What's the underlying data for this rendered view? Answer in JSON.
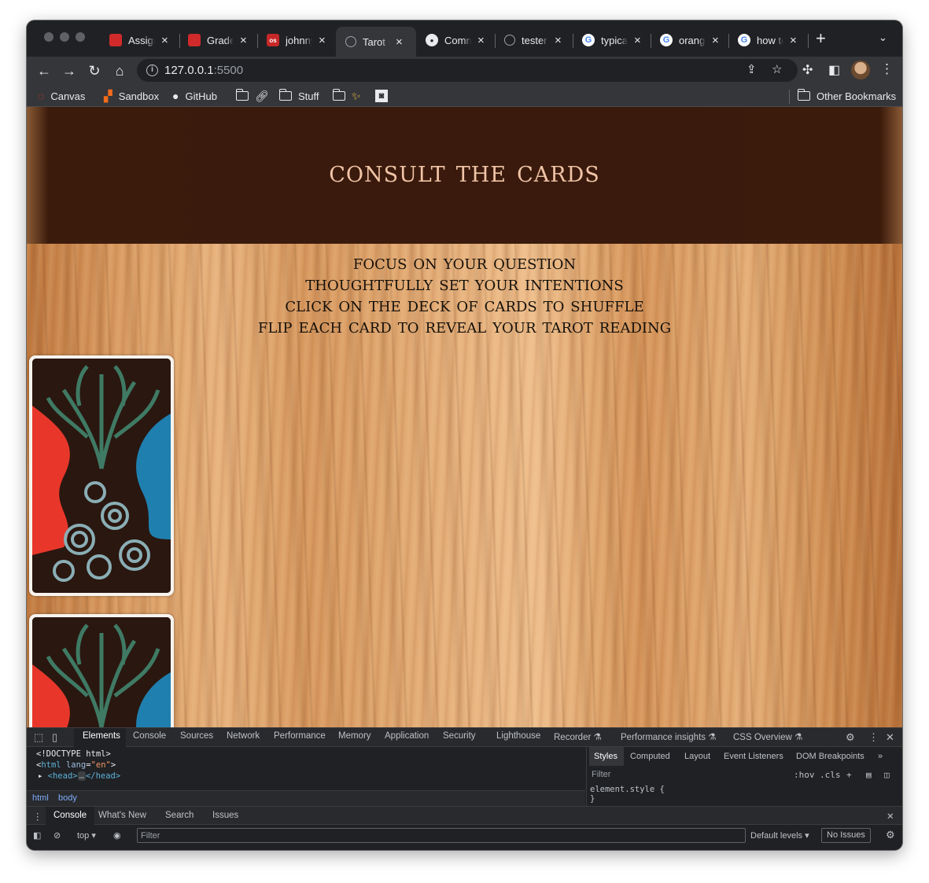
{
  "browser": {
    "tabs": [
      {
        "title": "Assignments",
        "favicon": "red-square-icon",
        "color": "#d12a2a"
      },
      {
        "title": "Grades",
        "favicon": "red-square-icon",
        "color": "#d12a2a"
      },
      {
        "title": "johnny",
        "favicon": "os-icon",
        "color": "#c62828"
      },
      {
        "title": "Tarot Cards",
        "favicon": "globe-icon",
        "color": "#9aa0a6",
        "active": true
      },
      {
        "title": "Commits",
        "favicon": "github-icon",
        "color": "#e8eaed"
      },
      {
        "title": "tester",
        "favicon": "globe-icon",
        "color": "#9aa0a6"
      },
      {
        "title": "typical",
        "favicon": "google-icon",
        "color": "#4285f4"
      },
      {
        "title": "orange",
        "favicon": "google-icon",
        "color": "#4285f4"
      },
      {
        "title": "how to",
        "favicon": "google-icon",
        "color": "#4285f4"
      }
    ],
    "url_host": "127.0.0.1",
    "url_port": ":5500",
    "bookmarks": {
      "canvas": "Canvas",
      "sandbox": "Sandbox",
      "github": "GitHub",
      "stuff": "Stuff",
      "other": "Other Bookmarks"
    }
  },
  "page": {
    "title": "Consult the Cards",
    "instructions": [
      "Focus on your question",
      "Thoughtfully set your intentions",
      "Click on the deck of cards to shuffle",
      "Flip each card to reveal your tarot reading"
    ]
  },
  "devtools": {
    "tabs": [
      "Elements",
      "Console",
      "Sources",
      "Network",
      "Performance",
      "Memory",
      "Application",
      "Security",
      "Lighthouse",
      "Recorder",
      "Performance insights",
      "CSS Overview"
    ],
    "code": {
      "doctype": "<!DOCTYPE html>",
      "html_tag": "html",
      "lang_attr": "lang",
      "lang_val": "\"en\"",
      "head_tag": "head",
      "head_close": "</head>"
    },
    "crumbs": [
      "html",
      "body"
    ],
    "styles_tabs": [
      "Styles",
      "Computed",
      "Layout",
      "Event Listeners",
      "DOM Breakpoints"
    ],
    "styles_filter": "Filter",
    "styles_hov": ":hov",
    "styles_cls": ".cls",
    "element_style": "element.style {",
    "element_style_close": "}",
    "console_tabs": [
      "Console",
      "What's New",
      "Search",
      "Issues"
    ],
    "context": "top",
    "console_filter": "Filter",
    "levels": "Default levels",
    "issues": "No Issues"
  }
}
